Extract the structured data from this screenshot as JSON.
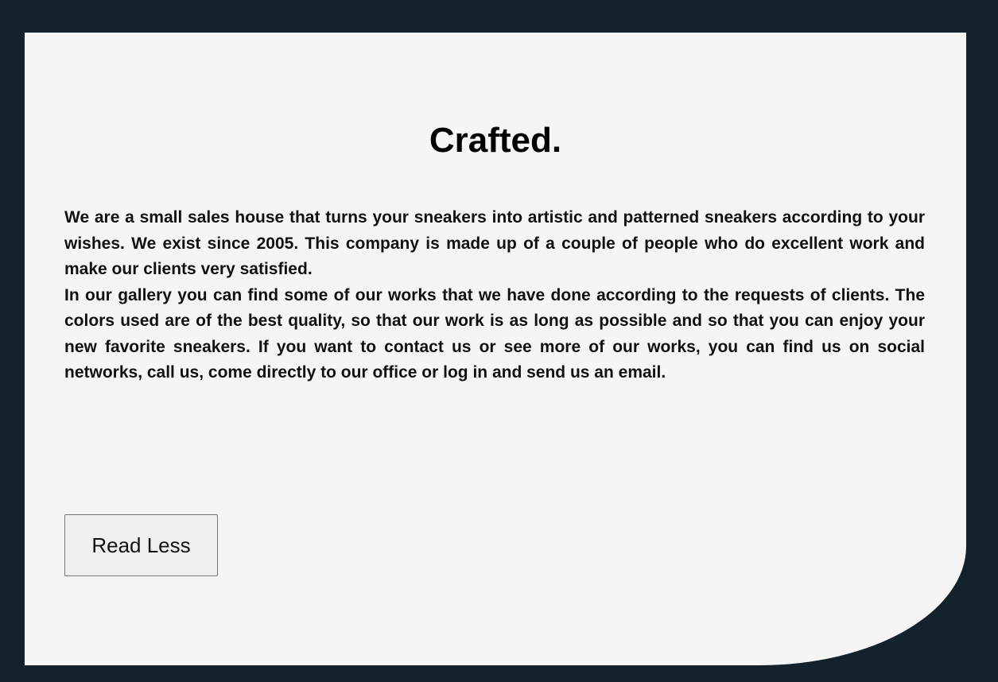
{
  "heading": "Crafted.",
  "paragraphs": [
    "We are a small sales house that turns your sneakers into artistic and patterned sneakers according to your wishes. We exist since 2005. This company is made up of a couple of people who do excellent work and make our clients very satisfied.",
    "In our gallery you can find some of our works that we have done according to the requests of clients. The colors used are of the best quality, so that our work is as long as possible and so that you can enjoy your new favorite sneakers. If you want to contact us or see more of our works, you can find us on social networks, call us, come directly to our office or log in and send us an email."
  ],
  "button": {
    "label": "Read Less"
  },
  "colors": {
    "background": "#13222b",
    "card": "#f5f5f5",
    "text": "#111111"
  }
}
